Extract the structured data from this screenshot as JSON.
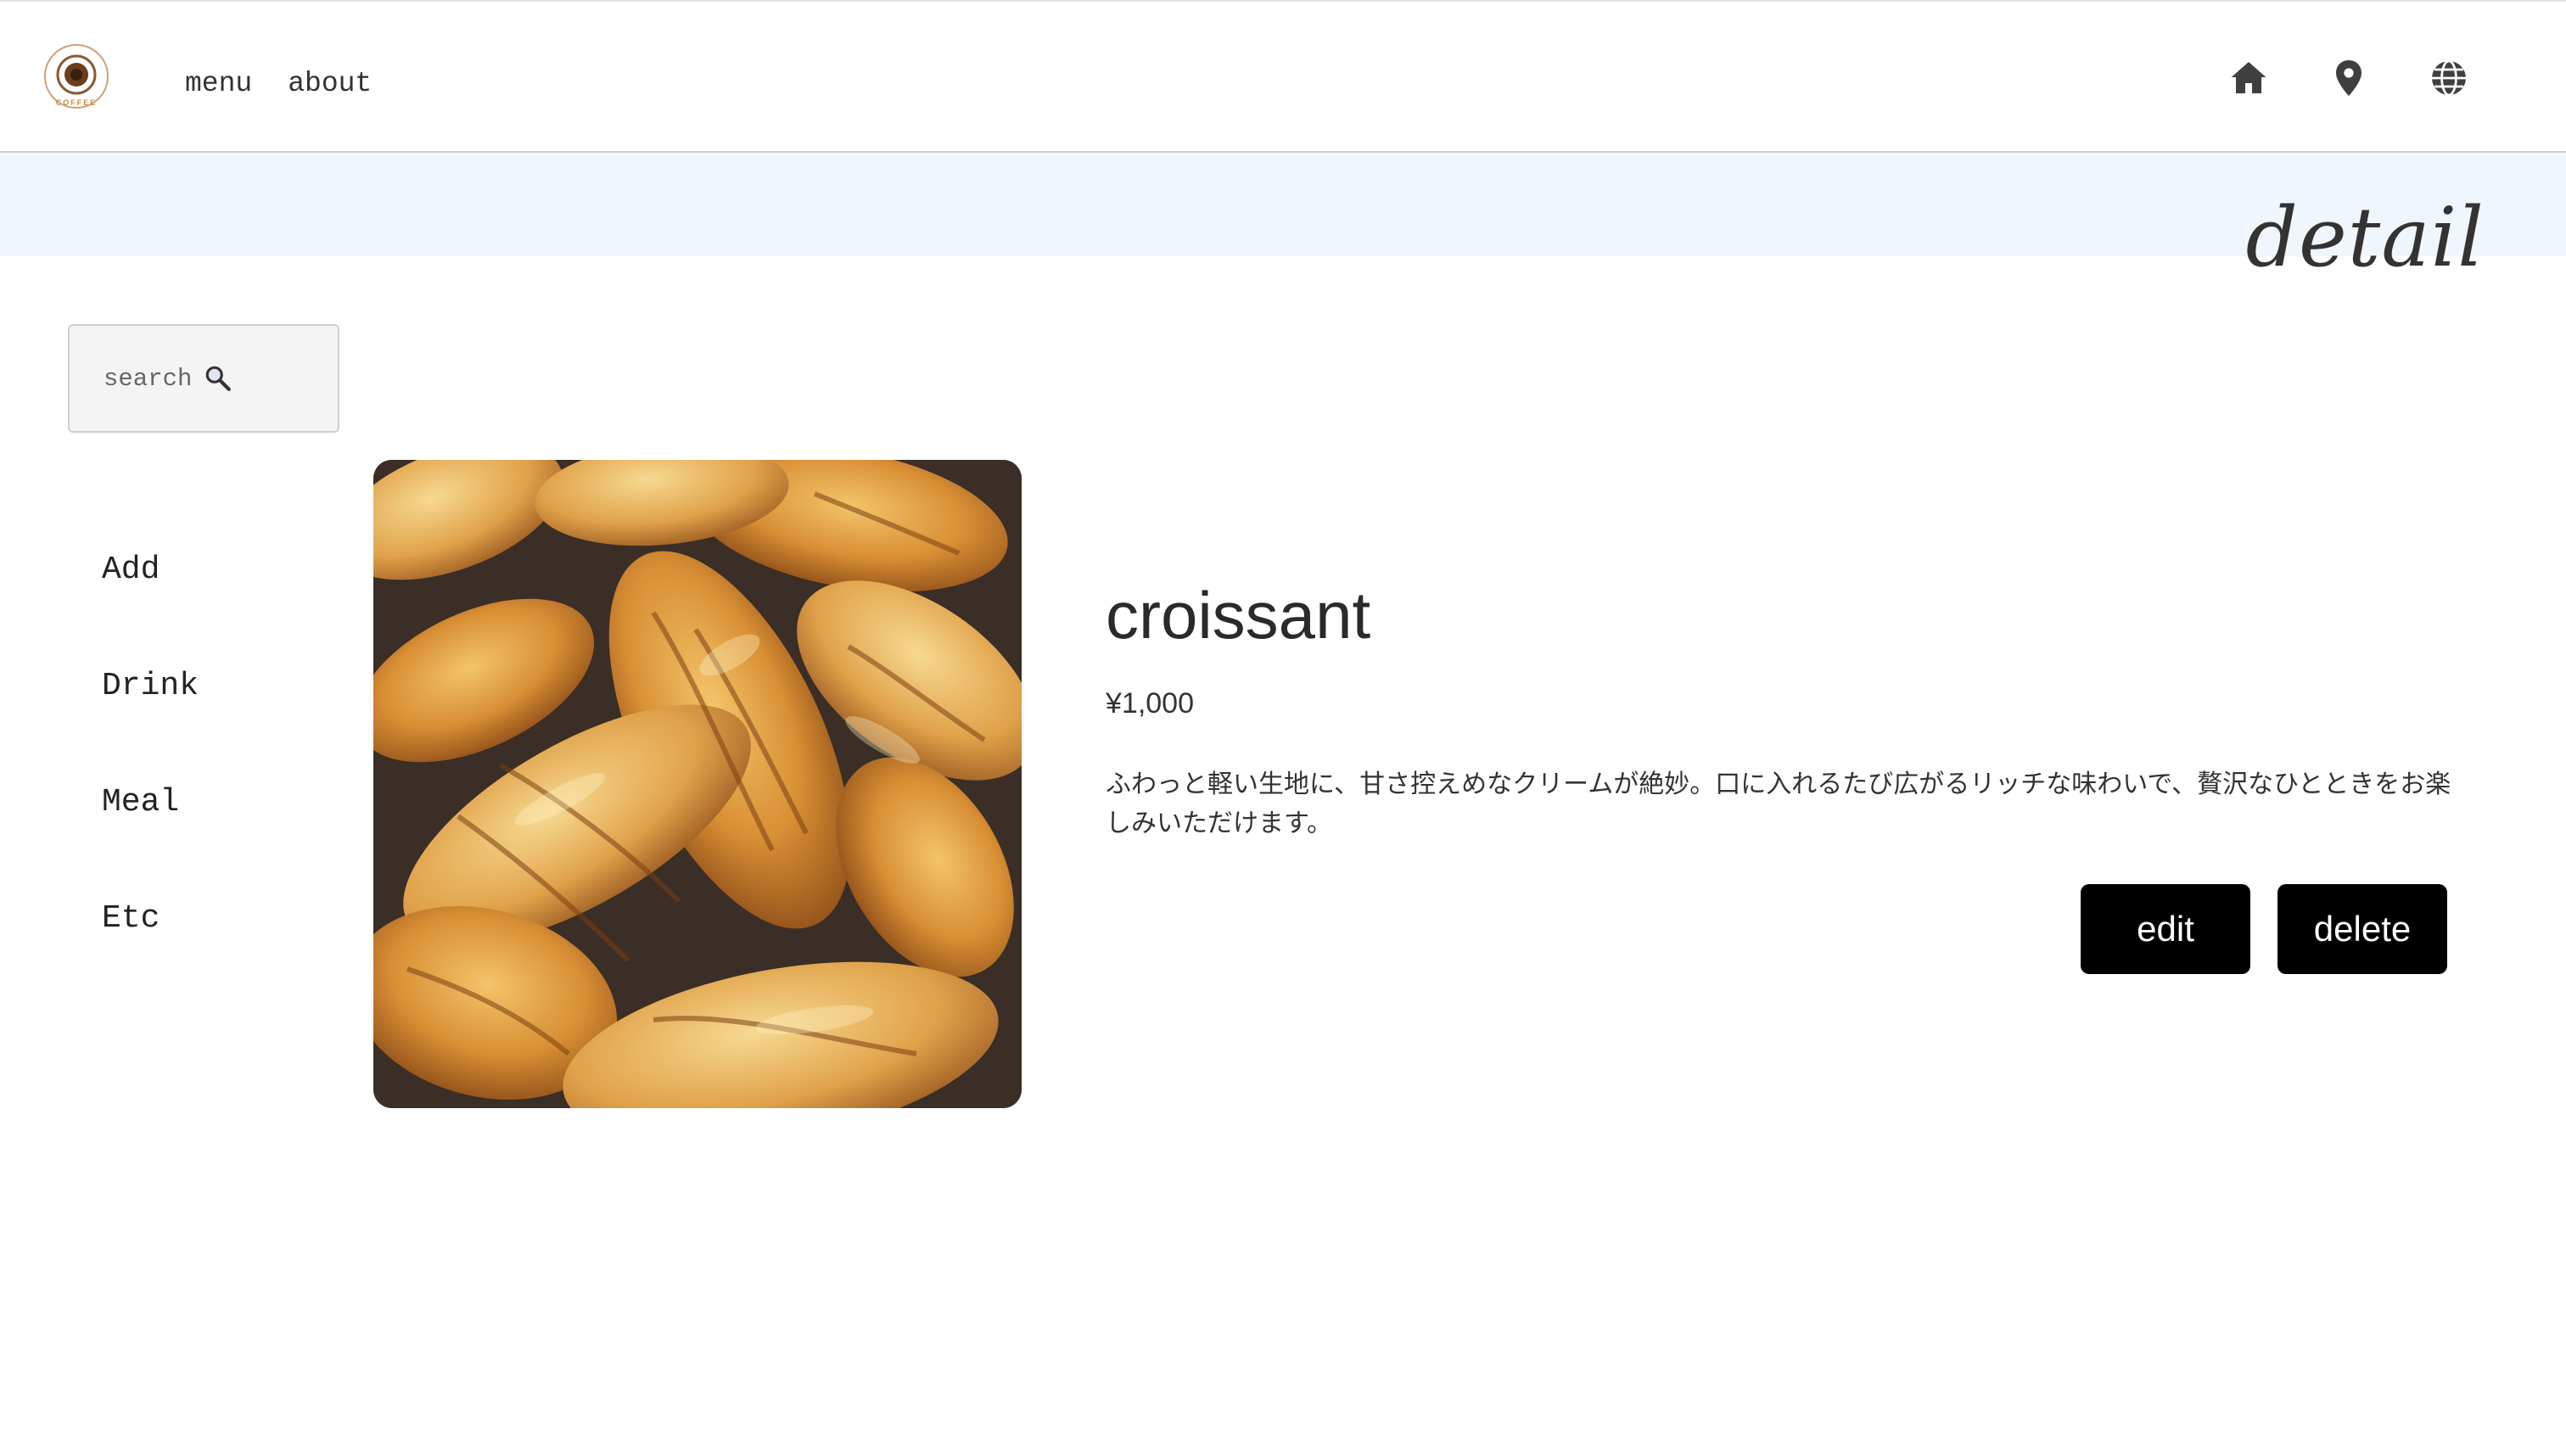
{
  "header": {
    "logo_icon": "coffee-cup-logo",
    "logo_text": "COFFEE",
    "nav": [
      {
        "label": "menu"
      },
      {
        "label": "about"
      }
    ],
    "icons": [
      "home-icon",
      "location-pin-icon",
      "globe-icon"
    ]
  },
  "page": {
    "title": "detail",
    "band_color": "#eff6fd"
  },
  "search": {
    "placeholder": "search",
    "icon": "magnifier-icon"
  },
  "sidebar": {
    "items": [
      {
        "label": "Add"
      },
      {
        "label": "Drink"
      },
      {
        "label": "Meal"
      },
      {
        "label": "Etc"
      }
    ]
  },
  "product": {
    "image": "croissant-photo",
    "name": "croissant",
    "price": "¥1,000",
    "description": "ふわっと軽い生地に、甘さ控えめなクリームが絶妙。口に入れるたび広がるリッチな味わいで、贅沢なひとときをお楽しみいただけます。"
  },
  "actions": {
    "edit_label": "edit",
    "delete_label": "delete",
    "button_color": "#000000"
  }
}
